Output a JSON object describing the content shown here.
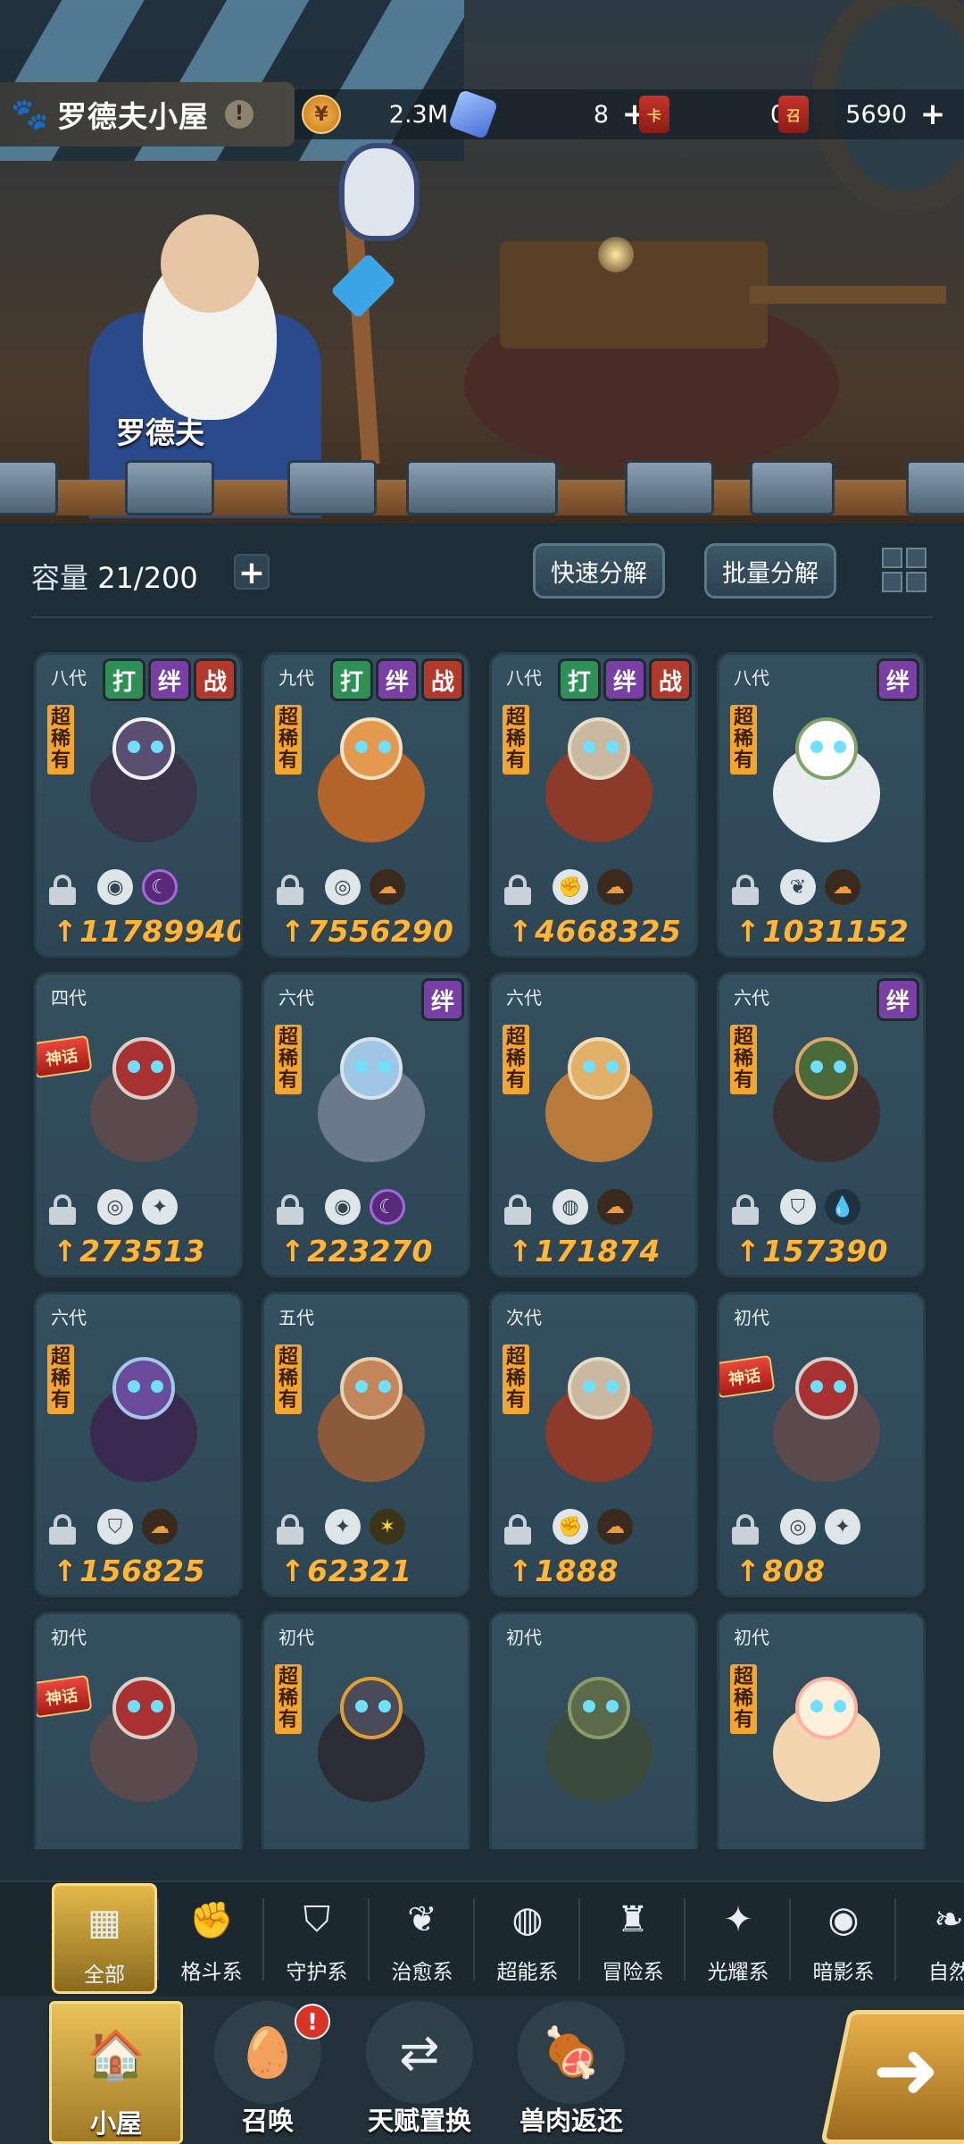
{
  "header": {
    "house_title": "罗德夫小屋",
    "info_icon": "!",
    "npc_name": "罗德夫"
  },
  "currencies": [
    {
      "icon": "coin-icon",
      "value": "2.3M"
    },
    {
      "icon": "gem-icon",
      "value": "8"
    },
    {
      "icon": "red-card-icon",
      "value": "0"
    },
    {
      "icon": "summon-card-icon",
      "value": "5690"
    }
  ],
  "plus": "+",
  "inventory": {
    "capacity_label": "容量",
    "capacity_value": "21/200",
    "quick_decompose": "快速分解",
    "batch_decompose": "批量分解"
  },
  "rarity_text": "超稀有",
  "myth_text": "神话",
  "cards": [
    {
      "gen": "八代",
      "tags": [
        "打",
        "绊",
        "战"
      ],
      "rarity": "super",
      "power": "11789940",
      "elems": [
        "shadow-icon",
        "dark-moon-icon"
      ]
    },
    {
      "gen": "九代",
      "tags": [
        "打",
        "绊",
        "战"
      ],
      "rarity": "super",
      "power": "7556290",
      "elems": [
        "guard-icon",
        "adventure-icon"
      ]
    },
    {
      "gen": "八代",
      "tags": [
        "打",
        "绊",
        "战"
      ],
      "rarity": "super",
      "power": "4668325",
      "elems": [
        "fight-icon",
        "adventure-icon"
      ]
    },
    {
      "gen": "八代",
      "tags": [
        "绊"
      ],
      "rarity": "super",
      "power": "1031152",
      "elems": [
        "heal-icon",
        "adventure-icon"
      ]
    },
    {
      "gen": "四代",
      "tags": [],
      "rarity": "myth",
      "power": "273513",
      "elems": [
        "guard-icon",
        "light-icon"
      ]
    },
    {
      "gen": "六代",
      "tags": [
        "绊"
      ],
      "rarity": "super",
      "power": "223270",
      "elems": [
        "shadow-icon",
        "dark-moon-icon"
      ]
    },
    {
      "gen": "六代",
      "tags": [],
      "rarity": "super",
      "power": "171874",
      "elems": [
        "psychic-icon",
        "adventure-icon"
      ]
    },
    {
      "gen": "六代",
      "tags": [
        "绊"
      ],
      "rarity": "super",
      "power": "157390",
      "elems": [
        "defense-icon",
        "water-icon"
      ]
    },
    {
      "gen": "六代",
      "tags": [],
      "rarity": "super",
      "power": "156825",
      "elems": [
        "defense-icon",
        "adventure-icon"
      ]
    },
    {
      "gen": "五代",
      "tags": [],
      "rarity": "super",
      "power": "62321",
      "elems": [
        "light-icon",
        "star-icon"
      ]
    },
    {
      "gen": "次代",
      "tags": [],
      "rarity": "super",
      "power": "1888",
      "elems": [
        "fight-icon",
        "adventure-icon"
      ]
    },
    {
      "gen": "初代",
      "tags": [],
      "rarity": "myth",
      "power": "808",
      "elems": [
        "guard-icon",
        "light-icon"
      ]
    },
    {
      "gen": "初代",
      "tags": [],
      "rarity": "myth",
      "power": "",
      "elems": []
    },
    {
      "gen": "初代",
      "tags": [],
      "rarity": "super",
      "power": "",
      "elems": []
    },
    {
      "gen": "初代",
      "tags": [],
      "rarity": "none",
      "power": "",
      "elems": []
    },
    {
      "gen": "初代",
      "tags": [],
      "rarity": "super",
      "power": "",
      "elems": []
    }
  ],
  "categories": [
    {
      "label": "全部",
      "icon": "all-blocks-icon"
    },
    {
      "label": "格斗系",
      "icon": "fist-icon"
    },
    {
      "label": "守护系",
      "icon": "shield-icon"
    },
    {
      "label": "治愈系",
      "icon": "sprout-icon"
    },
    {
      "label": "超能系",
      "icon": "alien-icon"
    },
    {
      "label": "冒险系",
      "icon": "lantern-icon"
    },
    {
      "label": "光耀系",
      "icon": "sparkle-icon"
    },
    {
      "label": "暗影系",
      "icon": "eye-icon"
    },
    {
      "label": "自然",
      "icon": "leaf-icon"
    }
  ],
  "bottom_nav": [
    {
      "label": "小屋",
      "icon": "house-icon"
    },
    {
      "label": "召唤",
      "icon": "egg-icon"
    },
    {
      "label": "天赋置换",
      "icon": "swap-icon"
    },
    {
      "label": "兽肉返还",
      "icon": "meat-icon"
    }
  ],
  "summon_badge": "!"
}
